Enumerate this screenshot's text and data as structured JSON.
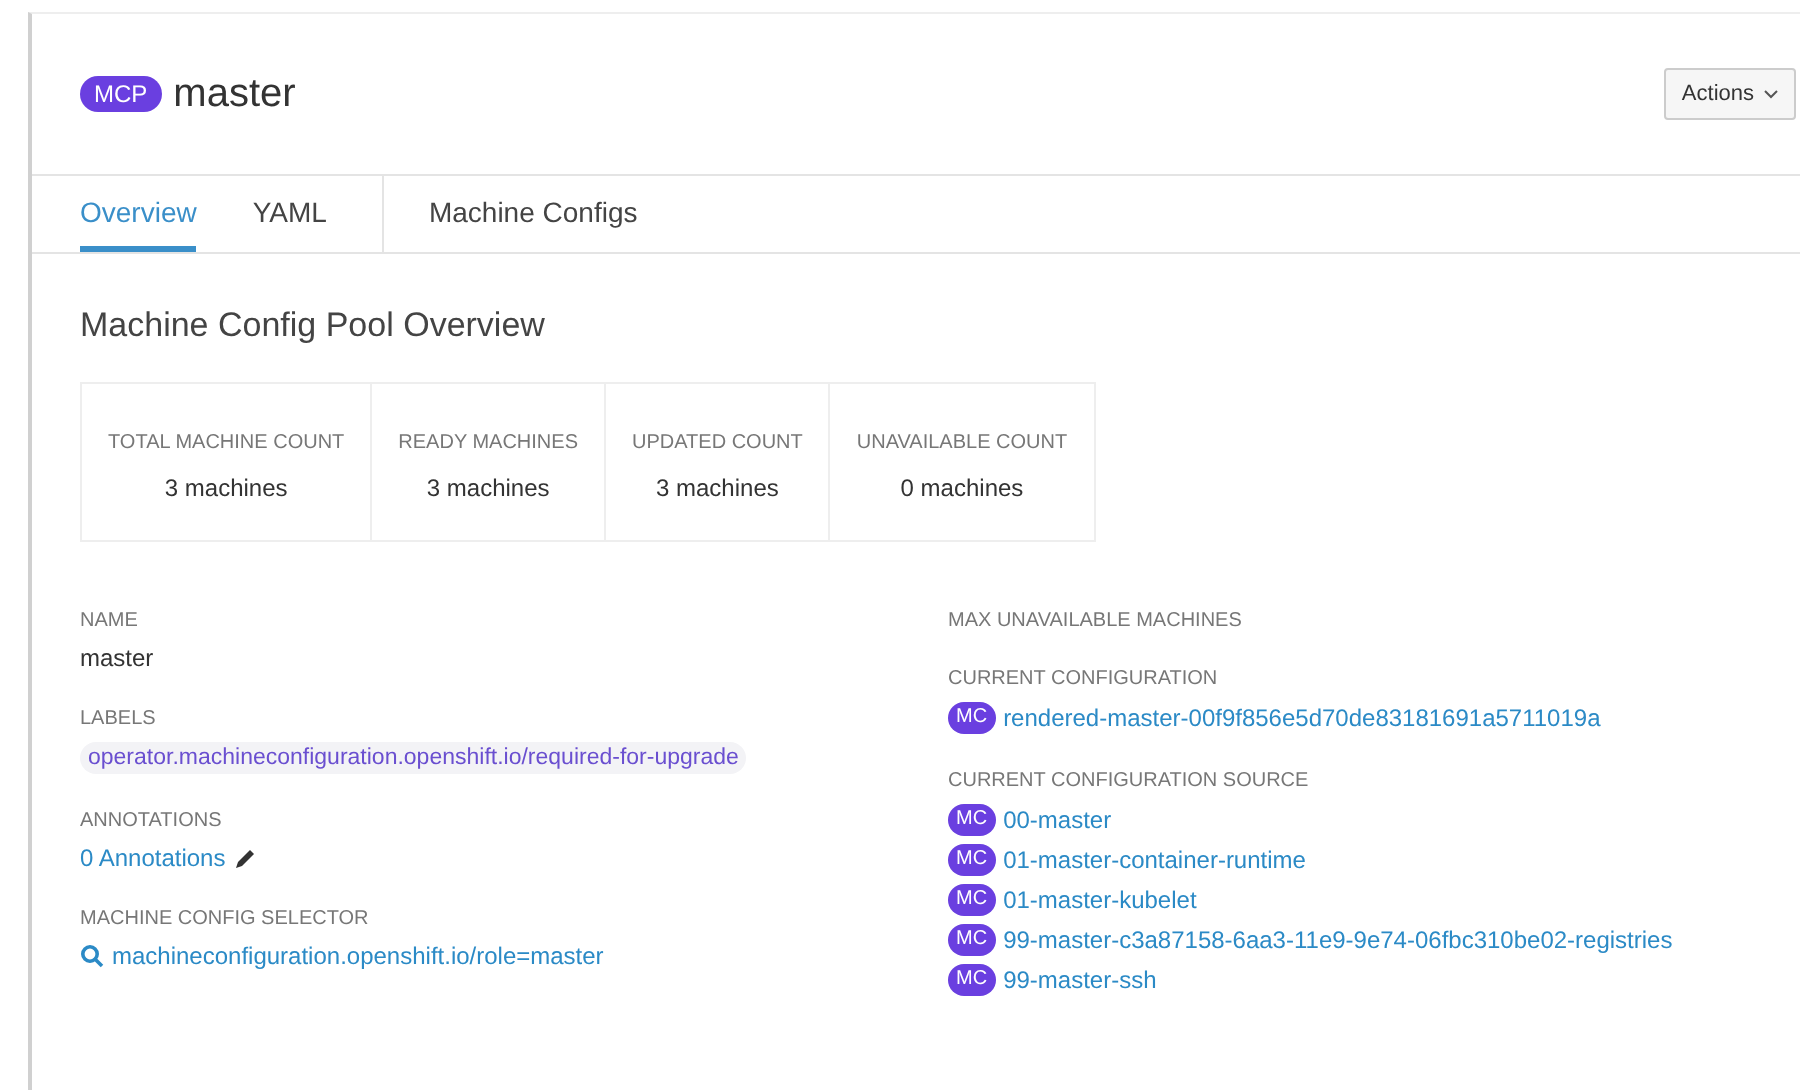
{
  "header": {
    "badge": "MCP",
    "title": "master",
    "actions_button": "Actions"
  },
  "tabs": [
    {
      "label": "Overview",
      "selected": true
    },
    {
      "label": "YAML",
      "selected": false
    },
    {
      "label": "Machine Configs",
      "selected": false
    }
  ],
  "section_title": "Machine Config Pool Overview",
  "stats": [
    {
      "label": "TOTAL MACHINE COUNT",
      "value": "3 machines"
    },
    {
      "label": "READY MACHINES",
      "value": "3 machines"
    },
    {
      "label": "UPDATED COUNT",
      "value": "3 machines"
    },
    {
      "label": "UNAVAILABLE COUNT",
      "value": "0 machines"
    }
  ],
  "left_details": [
    {
      "kind": "text",
      "label": "NAME",
      "value": "master"
    },
    {
      "kind": "label_chip",
      "label": "LABELS",
      "value": "operator.machineconfiguration.openshift.io/required-for-upgrade"
    },
    {
      "kind": "edit_link",
      "label": "ANNOTATIONS",
      "value": "0 Annotations"
    },
    {
      "kind": "search_link",
      "label": "MACHINE CONFIG SELECTOR",
      "value": "machineconfiguration.openshift.io/role=master"
    }
  ],
  "right_details": [
    {
      "label": "MAX UNAVAILABLE MACHINES"
    },
    {
      "label": "CURRENT CONFIGURATION",
      "items": [
        {
          "badge": "MC",
          "name": "rendered-master-00f9f856e5d70de83181691a5711019a"
        }
      ]
    },
    {
      "label": "CURRENT CONFIGURATION SOURCE",
      "items": [
        {
          "badge": "MC",
          "name": "00-master"
        },
        {
          "badge": "MC",
          "name": "01-master-container-runtime"
        },
        {
          "badge": "MC",
          "name": "01-master-kubelet"
        },
        {
          "badge": "MC",
          "name": "99-master-c3a87158-6aa3-11e9-9e74-06fbc310be02-registries"
        },
        {
          "badge": "MC",
          "name": "99-master-ssh"
        }
      ]
    }
  ]
}
